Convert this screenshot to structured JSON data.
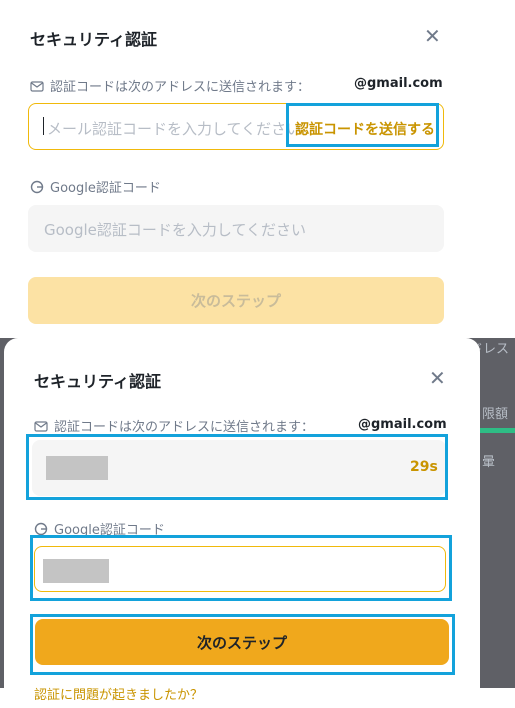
{
  "background": {
    "side_text_1": "ドレス",
    "side_text_2": "限額",
    "side_text_3": "暈"
  },
  "dialog_initial": {
    "title": "セキュリティ認証",
    "email_label": "認証コードは次のアドレスに送信されます：",
    "email_suffix": "@gmail.com",
    "email_code_placeholder": "メール認証コードを入力してください",
    "send_code_label": "認証コードを送信する",
    "google_label": "Google認証コード",
    "google_placeholder": "Google認証コードを入力してください",
    "next_button": "次のステップ"
  },
  "dialog_filled": {
    "title": "セキュリティ認証",
    "email_label": "認証コードは次のアドレスに送信されます：",
    "email_suffix": "@gmail.com",
    "countdown": "29s",
    "google_label": "Google認証コード",
    "next_button": "次のステップ",
    "bottom_link": "認証に問題が起きましたか？"
  },
  "icons": {
    "close": "close-icon",
    "email": "mail-icon",
    "google": "google-icon"
  },
  "colors": {
    "accent": "#f0a81c",
    "accent_text": "#c99400",
    "highlight_box": "#13a2db",
    "disabled_button": "#fce2a4",
    "overlay": "#5f6066"
  }
}
